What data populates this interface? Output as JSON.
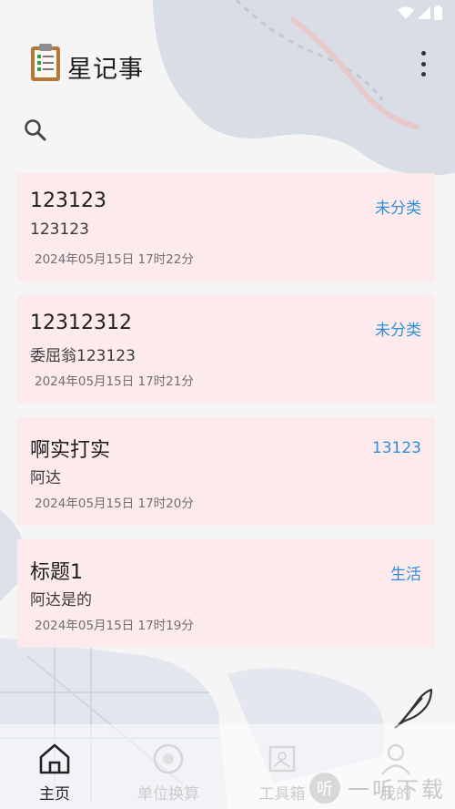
{
  "app": {
    "title": "星记事"
  },
  "notes": [
    {
      "title": "123123",
      "body": "123123",
      "date": "2024年05月15日 17时22分",
      "category": "未分类"
    },
    {
      "title": "12312312",
      "body": "委屈翁123123",
      "date": "2024年05月15日 17时21分",
      "category": "未分类"
    },
    {
      "title": "啊实打实",
      "body": "阿达",
      "date": "2024年05月15日 17时20分",
      "category": "13123"
    },
    {
      "title": "标题1",
      "body": "阿达是的",
      "date": "2024年05月15日 17时19分",
      "category": "生活"
    }
  ],
  "bottom_nav": [
    {
      "label": "主页",
      "icon": "home-icon",
      "active": true
    },
    {
      "label": "单位换算",
      "icon": "unit-convert-icon",
      "active": false
    },
    {
      "label": "工具箱",
      "icon": "toolbox-icon",
      "active": false
    },
    {
      "label": "我的",
      "icon": "profile-icon",
      "active": false
    }
  ],
  "watermark": {
    "badge": "听",
    "text": "一听下载"
  },
  "colors": {
    "card_bg": "#fde9ec",
    "category": "#2f8fd6",
    "background": "#f5f5f6"
  }
}
